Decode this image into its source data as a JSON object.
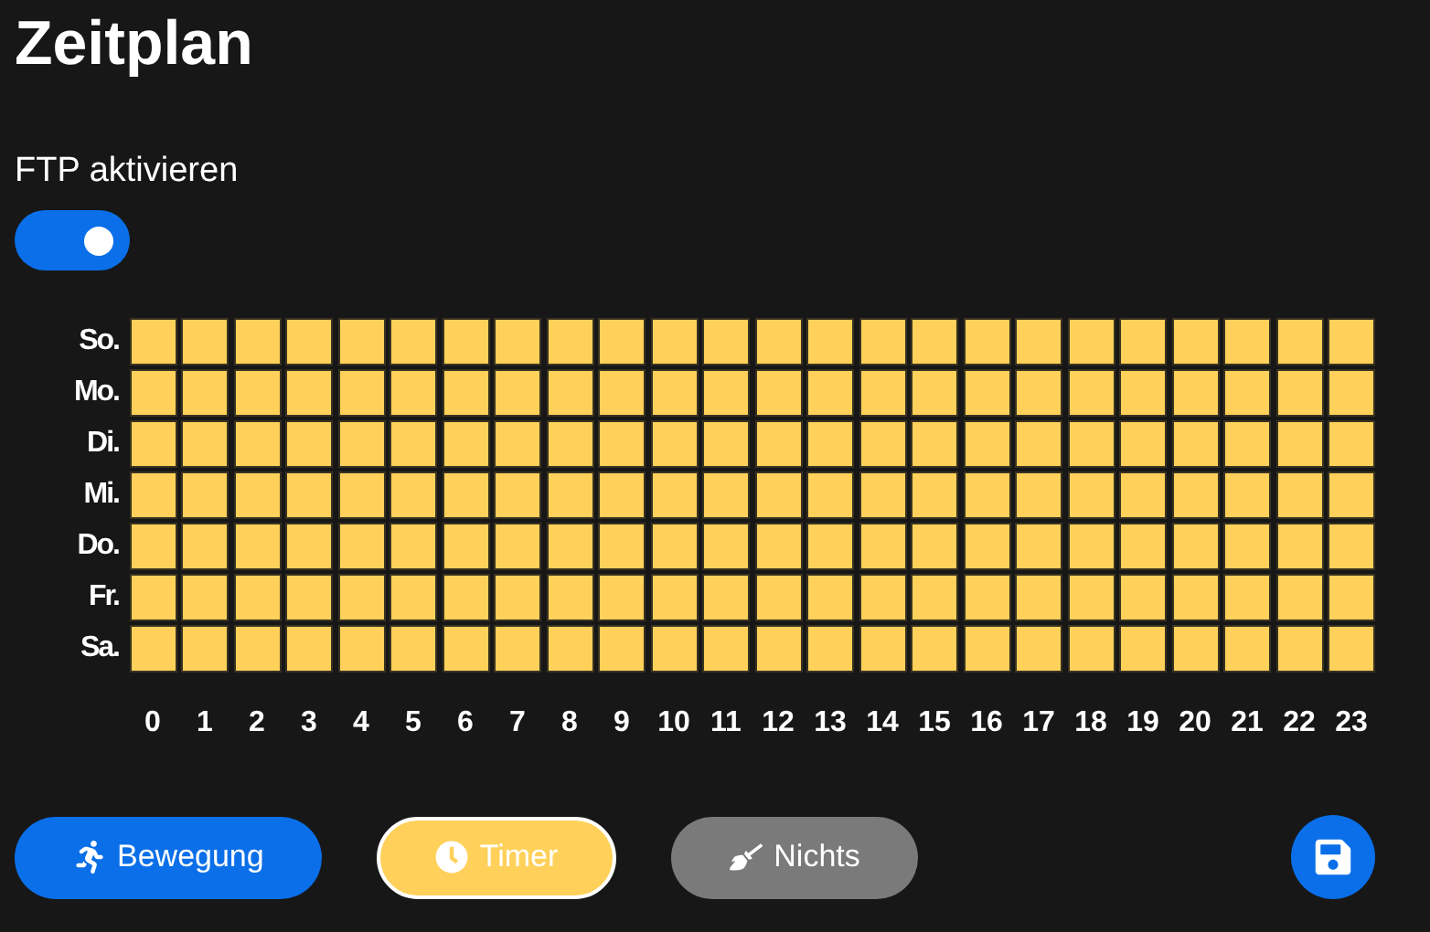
{
  "title": "Zeitplan",
  "ftp": {
    "label": "FTP aktivieren",
    "on": true
  },
  "schedule": {
    "rows": [
      {
        "day": "So.",
        "slots": [
          {
            "kind": "timer"
          },
          {
            "kind": "timer"
          },
          {
            "kind": "timer"
          },
          {
            "kind": "timer"
          },
          {
            "kind": "timer"
          },
          {
            "kind": "timer"
          },
          {
            "kind": "timer"
          },
          {
            "kind": "timer"
          },
          {
            "kind": "timer"
          },
          {
            "kind": "timer"
          },
          {
            "kind": "timer"
          },
          {
            "kind": "timer"
          },
          {
            "kind": "timer"
          },
          {
            "kind": "timer"
          },
          {
            "kind": "timer"
          },
          {
            "kind": "timer"
          },
          {
            "kind": "timer"
          },
          {
            "kind": "timer"
          },
          {
            "kind": "timer"
          },
          {
            "kind": "timer"
          },
          {
            "kind": "timer"
          },
          {
            "kind": "timer"
          },
          {
            "kind": "timer"
          },
          {
            "kind": "timer"
          }
        ]
      },
      {
        "day": "Mo.",
        "slots": [
          {
            "kind": "timer"
          },
          {
            "kind": "timer"
          },
          {
            "kind": "timer"
          },
          {
            "kind": "timer"
          },
          {
            "kind": "timer"
          },
          {
            "kind": "timer"
          },
          {
            "kind": "timer"
          },
          {
            "kind": "timer"
          },
          {
            "kind": "timer"
          },
          {
            "kind": "timer"
          },
          {
            "kind": "timer"
          },
          {
            "kind": "timer"
          },
          {
            "kind": "timer"
          },
          {
            "kind": "timer"
          },
          {
            "kind": "timer"
          },
          {
            "kind": "timer"
          },
          {
            "kind": "timer"
          },
          {
            "kind": "timer"
          },
          {
            "kind": "timer"
          },
          {
            "kind": "timer"
          },
          {
            "kind": "timer"
          },
          {
            "kind": "timer"
          },
          {
            "kind": "timer"
          },
          {
            "kind": "timer"
          }
        ]
      },
      {
        "day": "Di.",
        "slots": [
          {
            "kind": "timer"
          },
          {
            "kind": "timer"
          },
          {
            "kind": "timer"
          },
          {
            "kind": "timer"
          },
          {
            "kind": "timer"
          },
          {
            "kind": "timer"
          },
          {
            "kind": "timer"
          },
          {
            "kind": "timer"
          },
          {
            "kind": "timer"
          },
          {
            "kind": "timer"
          },
          {
            "kind": "timer"
          },
          {
            "kind": "timer"
          },
          {
            "kind": "timer"
          },
          {
            "kind": "timer"
          },
          {
            "kind": "timer"
          },
          {
            "kind": "timer"
          },
          {
            "kind": "timer"
          },
          {
            "kind": "timer"
          },
          {
            "kind": "timer"
          },
          {
            "kind": "timer"
          },
          {
            "kind": "timer"
          },
          {
            "kind": "timer"
          },
          {
            "kind": "timer"
          },
          {
            "kind": "timer"
          }
        ]
      },
      {
        "day": "Mi.",
        "slots": [
          {
            "kind": "timer"
          },
          {
            "kind": "timer"
          },
          {
            "kind": "timer"
          },
          {
            "kind": "timer"
          },
          {
            "kind": "timer"
          },
          {
            "kind": "timer"
          },
          {
            "kind": "timer"
          },
          {
            "kind": "timer"
          },
          {
            "kind": "timer"
          },
          {
            "kind": "timer"
          },
          {
            "kind": "timer"
          },
          {
            "kind": "timer"
          },
          {
            "kind": "timer"
          },
          {
            "kind": "timer"
          },
          {
            "kind": "timer"
          },
          {
            "kind": "timer"
          },
          {
            "kind": "timer"
          },
          {
            "kind": "timer"
          },
          {
            "kind": "timer"
          },
          {
            "kind": "timer"
          },
          {
            "kind": "timer"
          },
          {
            "kind": "timer"
          },
          {
            "kind": "timer"
          },
          {
            "kind": "timer"
          }
        ]
      },
      {
        "day": "Do.",
        "slots": [
          {
            "kind": "timer"
          },
          {
            "kind": "timer"
          },
          {
            "kind": "timer"
          },
          {
            "kind": "timer"
          },
          {
            "kind": "timer"
          },
          {
            "kind": "timer"
          },
          {
            "kind": "timer"
          },
          {
            "kind": "timer"
          },
          {
            "kind": "timer"
          },
          {
            "kind": "timer"
          },
          {
            "kind": "timer"
          },
          {
            "kind": "timer"
          },
          {
            "kind": "timer"
          },
          {
            "kind": "timer"
          },
          {
            "kind": "timer"
          },
          {
            "kind": "timer"
          },
          {
            "kind": "timer"
          },
          {
            "kind": "timer"
          },
          {
            "kind": "timer"
          },
          {
            "kind": "timer"
          },
          {
            "kind": "timer"
          },
          {
            "kind": "timer"
          },
          {
            "kind": "timer"
          },
          {
            "kind": "timer"
          }
        ]
      },
      {
        "day": "Fr.",
        "slots": [
          {
            "kind": "timer"
          },
          {
            "kind": "timer"
          },
          {
            "kind": "timer"
          },
          {
            "kind": "timer"
          },
          {
            "kind": "timer"
          },
          {
            "kind": "timer"
          },
          {
            "kind": "timer"
          },
          {
            "kind": "timer"
          },
          {
            "kind": "timer"
          },
          {
            "kind": "timer"
          },
          {
            "kind": "timer"
          },
          {
            "kind": "timer"
          },
          {
            "kind": "timer"
          },
          {
            "kind": "timer"
          },
          {
            "kind": "timer"
          },
          {
            "kind": "timer"
          },
          {
            "kind": "timer"
          },
          {
            "kind": "timer"
          },
          {
            "kind": "timer"
          },
          {
            "kind": "timer"
          },
          {
            "kind": "timer"
          },
          {
            "kind": "timer"
          },
          {
            "kind": "timer"
          },
          {
            "kind": "timer"
          }
        ]
      },
      {
        "day": "Sa.",
        "slots": [
          {
            "kind": "timer"
          },
          {
            "kind": "timer"
          },
          {
            "kind": "timer"
          },
          {
            "kind": "timer"
          },
          {
            "kind": "timer"
          },
          {
            "kind": "timer"
          },
          {
            "kind": "timer"
          },
          {
            "kind": "timer"
          },
          {
            "kind": "timer"
          },
          {
            "kind": "timer"
          },
          {
            "kind": "timer"
          },
          {
            "kind": "timer"
          },
          {
            "kind": "timer"
          },
          {
            "kind": "timer"
          },
          {
            "kind": "timer"
          },
          {
            "kind": "timer"
          },
          {
            "kind": "timer"
          },
          {
            "kind": "timer"
          },
          {
            "kind": "timer"
          },
          {
            "kind": "timer"
          },
          {
            "kind": "timer"
          },
          {
            "kind": "timer"
          },
          {
            "kind": "timer"
          },
          {
            "kind": "timer"
          }
        ]
      }
    ],
    "hours": [
      "0",
      "1",
      "2",
      "3",
      "4",
      "5",
      "6",
      "7",
      "8",
      "9",
      "10",
      "11",
      "12",
      "13",
      "14",
      "15",
      "16",
      "17",
      "18",
      "19",
      "20",
      "21",
      "22",
      "23"
    ]
  },
  "modes": [
    {
      "kind": "motion",
      "label": "Bewegung",
      "selected": false
    },
    {
      "kind": "timer",
      "label": "Timer",
      "selected": true
    },
    {
      "kind": "none",
      "label": "Nichts",
      "selected": false
    }
  ]
}
